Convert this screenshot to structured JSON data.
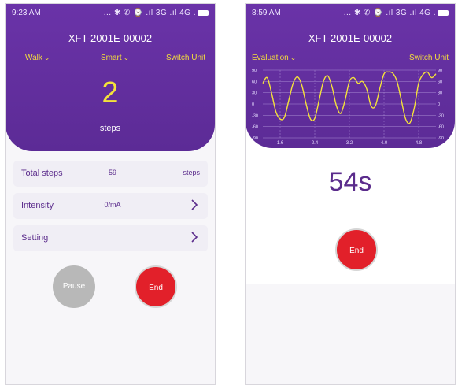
{
  "left_screen": {
    "status": {
      "time": "9:23 AM",
      "icons": "... ✱ ✆ ⌚ .ıl 3G .ıl 4G ."
    },
    "title": "XFT-2001E-00002",
    "menu": {
      "mode": "Walk",
      "smart": "Smart",
      "switch_unit": "Switch Unit"
    },
    "counter": {
      "value": "2",
      "unit": "steps"
    },
    "rows": {
      "total_steps": {
        "label": "Total steps",
        "value": "59",
        "unit": "steps"
      },
      "intensity": {
        "label": "Intensity",
        "value": "0/mA"
      },
      "setting": {
        "label": "Setting"
      }
    },
    "buttons": {
      "pause": "Pause",
      "end": "End"
    }
  },
  "right_screen": {
    "status": {
      "time": "8:59 AM",
      "icons": "... ✱ ✆ ⌚ .ıl 3G .ıl 4G ."
    },
    "title": "XFT-2001E-00002",
    "menu": {
      "mode": "Evaluation",
      "switch_unit": "Switch Unit"
    },
    "timer": "54s",
    "buttons": {
      "end": "End"
    }
  },
  "chart_data": {
    "type": "line",
    "title": "",
    "xlabel": "",
    "ylabel": "",
    "x_ticks": [
      "1.6",
      "2.4",
      "3.2",
      "4.0",
      "4.8"
    ],
    "y_ticks": [
      "90",
      "60",
      "30",
      "0",
      "-30",
      "-60",
      "-90"
    ],
    "xlim": [
      1.2,
      5.2
    ],
    "ylim": [
      -90,
      90
    ],
    "grid": true,
    "series": [
      {
        "color": "#f4e23a",
        "x": [
          1.2,
          1.3,
          1.4,
          1.5,
          1.6,
          1.7,
          1.8,
          1.9,
          2.0,
          2.1,
          2.2,
          2.3,
          2.4,
          2.5,
          2.6,
          2.7,
          2.8,
          2.9,
          3.0,
          3.1,
          3.2,
          3.3,
          3.4,
          3.5,
          3.6,
          3.7,
          3.8,
          3.9,
          4.0,
          4.1,
          4.2,
          4.3,
          4.4,
          4.5,
          4.6,
          4.7,
          4.8,
          4.9,
          5.0,
          5.1,
          5.2
        ],
        "y": [
          55,
          70,
          30,
          -20,
          -40,
          -35,
          10,
          55,
          72,
          50,
          0,
          -40,
          -38,
          10,
          60,
          75,
          45,
          -5,
          -25,
          10,
          60,
          70,
          55,
          60,
          40,
          -5,
          -5,
          40,
          80,
          85,
          82,
          60,
          10,
          -40,
          -50,
          -10,
          55,
          78,
          85,
          70,
          80
        ]
      }
    ]
  },
  "colors": {
    "header_purple": "#5c2b96",
    "accent_yellow": "#f4e23a",
    "end_red": "#e2202a",
    "pause_gray": "#b8b8b8"
  },
  "icons": {
    "chevron_right": "chevron-right-icon",
    "chevron_down": "chevron-down-icon"
  }
}
